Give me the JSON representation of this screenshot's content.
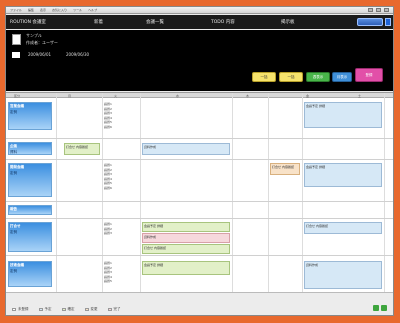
{
  "titlebar": {
    "menu": [
      "ファイル",
      "編集",
      "表示",
      "お気に入り",
      "ツール",
      "ヘルプ"
    ]
  },
  "navbar": {
    "items": [
      "ROUTION 会議室",
      "新着",
      "会議一覧",
      "TODO 内容",
      "掲示板"
    ]
  },
  "header": {
    "name": "サンプル",
    "sub": "作成者：ユーザー",
    "date_label": "日付範囲",
    "date_from": "2009/06/01",
    "date_to": "2009/06/30"
  },
  "toolbar": {
    "buttons": [
      "一括",
      "一括",
      "週表示",
      "月表示",
      "登録"
    ]
  },
  "grid": {
    "columns": [
      "区分",
      "月",
      "火",
      "水",
      "木",
      "金",
      "土"
    ],
    "rows": [
      {
        "label": "営業会議",
        "sub": "定例"
      },
      {
        "label": "企画",
        "sub": "資料"
      },
      {
        "label": "開発会議",
        "sub": "定例"
      },
      {
        "label": "報告",
        "sub": ""
      },
      {
        "label": "打合せ",
        "sub": "定例"
      },
      {
        "label": "技術会議",
        "sub": "定例"
      }
    ],
    "items": [
      "議題1",
      "議題2",
      "議題3",
      "議題4",
      "議題5",
      "議題6"
    ],
    "notes": [
      "会議予定 詳細",
      "打合せ 内容確認",
      "資料作成"
    ]
  },
  "footer": {
    "legend": [
      "未登録",
      "予定",
      "確定",
      "変更",
      "完了"
    ]
  },
  "colors": {
    "accent": "#3b8fe0",
    "background": "#e8692e",
    "header_bg": "#000000"
  }
}
